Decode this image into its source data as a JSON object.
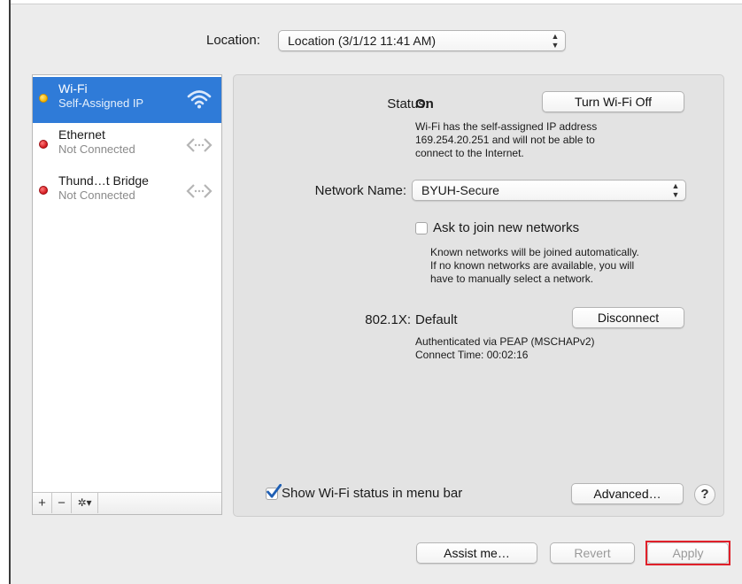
{
  "location": {
    "label": "Location:",
    "value": "Location (3/1/12 11:41 AM)"
  },
  "sidebar": {
    "services": [
      {
        "name": "Wi-Fi",
        "status": "Self-Assigned IP",
        "dot": "#f5b400",
        "icon": "wifi-icon",
        "selected": true
      },
      {
        "name": "Ethernet",
        "status": "Not Connected",
        "dot": "#d0161c",
        "icon": "ethernet-arrows-icon",
        "selected": false
      },
      {
        "name": "Thund…t Bridge",
        "status": "Not Connected",
        "dot": "#d0161c",
        "icon": "bridge-arrows-icon",
        "selected": false
      }
    ],
    "toolbar": {
      "add": "+",
      "remove": "−",
      "gear": "✲▾"
    }
  },
  "detail": {
    "status_label": "Status:",
    "status_value": "On",
    "turn_off_button": "Turn Wi-Fi Off",
    "status_desc_lines": [
      "Wi-Fi has the self-assigned IP address",
      "169.254.20.251 and will not be able to",
      "connect to the Internet."
    ],
    "network_name_label": "Network Name:",
    "network_name_value": "BYUH-Secure",
    "ask_join_label": "Ask to join new networks",
    "ask_join_checked": false,
    "ask_join_desc_lines": [
      "Known networks will be joined automatically.",
      "If no known networks are available, you will",
      "have to manually select a network."
    ],
    "dot1x_label": "802.1X:",
    "dot1x_value": "Default",
    "disconnect_button": "Disconnect",
    "auth_line": "Authenticated via PEAP (MSCHAPv2)",
    "connect_time_line": "Connect Time: 00:02:16",
    "show_status_label": "Show Wi-Fi status in menu bar",
    "show_status_checked": true,
    "advanced_button": "Advanced…",
    "help_button": "?"
  },
  "footer": {
    "assist_button": "Assist me…",
    "revert_button": "Revert",
    "apply_button": "Apply"
  },
  "colors": {
    "selection": "#2f7bd8",
    "highlight_outline": "#e0202a"
  }
}
